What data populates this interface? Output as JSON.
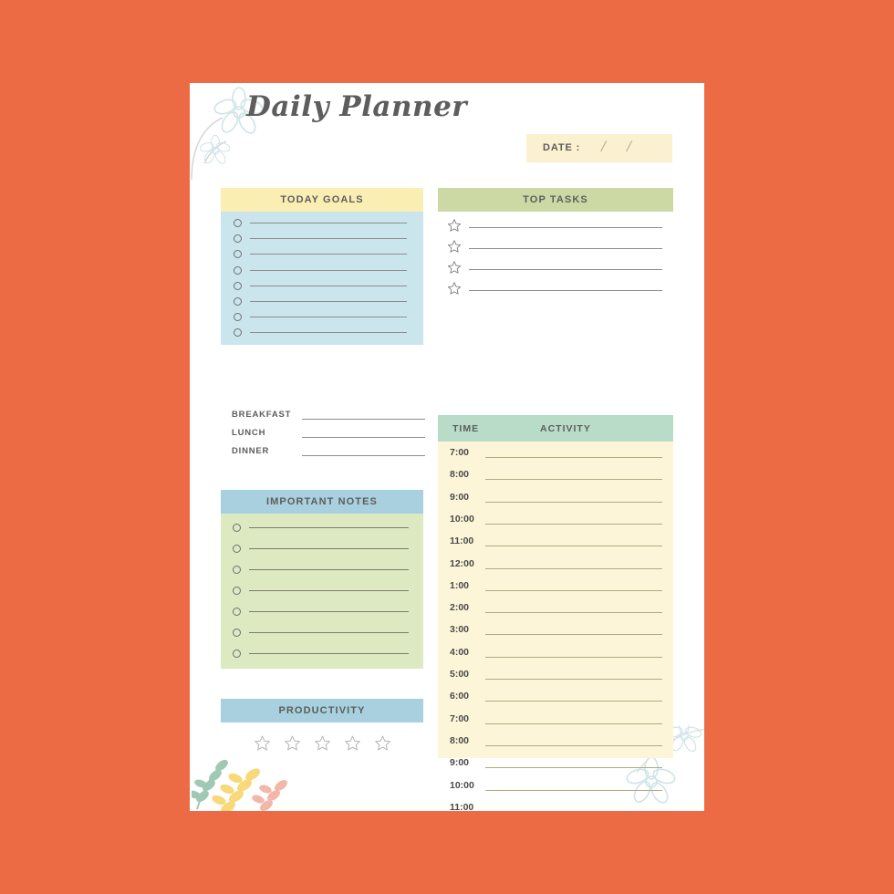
{
  "theme": {
    "background": "#ec6b44",
    "page": "#ffffff",
    "yellow_header": "#fbeeb3",
    "blue_body": "#cbe5ed",
    "green_header": "#ccd9a4",
    "mint_header": "#b9dcc8",
    "cream_body": "#fcf5d8",
    "blue_header": "#a9d0de",
    "green_body": "#dce9c1",
    "date_box": "#fbf0cf",
    "text": "#5d5d5d"
  },
  "header": {
    "title": "Daily Planner",
    "date_label": "DATE :",
    "date_slash_1": "/",
    "date_slash_2": "/"
  },
  "today_goals": {
    "title": "TODAY GOALS",
    "row_count": 8
  },
  "meals": {
    "items": [
      {
        "label": "BREAKFAST",
        "value": ""
      },
      {
        "label": "LUNCH",
        "value": ""
      },
      {
        "label": "DINNER",
        "value": ""
      }
    ]
  },
  "important_notes": {
    "title": "IMPORTANT NOTES",
    "row_count": 7
  },
  "productivity": {
    "title": "PRODUCTIVITY",
    "star_count": 5,
    "rating": 0
  },
  "top_tasks": {
    "title": "TOP TASKS",
    "row_count": 4
  },
  "schedule": {
    "col_time": "TIME",
    "col_activity": "ACTIVITY",
    "rows": [
      {
        "time": "7:00",
        "activity": ""
      },
      {
        "time": "8:00",
        "activity": ""
      },
      {
        "time": "9:00",
        "activity": ""
      },
      {
        "time": "10:00",
        "activity": ""
      },
      {
        "time": "11:00",
        "activity": ""
      },
      {
        "time": "12:00",
        "activity": ""
      },
      {
        "time": "1:00",
        "activity": ""
      },
      {
        "time": "2:00",
        "activity": ""
      },
      {
        "time": "3:00",
        "activity": ""
      },
      {
        "time": "4:00",
        "activity": ""
      },
      {
        "time": "5:00",
        "activity": ""
      },
      {
        "time": "6:00",
        "activity": ""
      },
      {
        "time": "7:00",
        "activity": ""
      },
      {
        "time": "8:00",
        "activity": ""
      },
      {
        "time": "9:00",
        "activity": ""
      },
      {
        "time": "10:00",
        "activity": ""
      },
      {
        "time": "11:00",
        "activity": ""
      }
    ]
  },
  "decorations": {
    "top_left": "flower-sprig-icon",
    "bottom_right": "flower-sprig-icon",
    "bottom_left": "leaf-branches-icon"
  }
}
